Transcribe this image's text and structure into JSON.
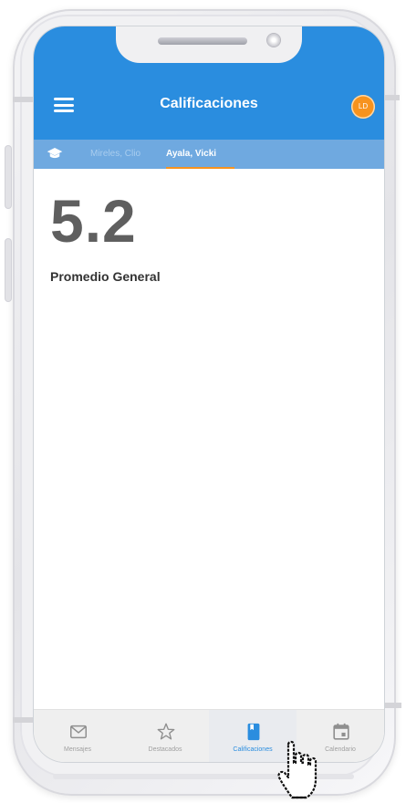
{
  "appbar": {
    "title": "Calificaciones",
    "avatar_initials": "LD",
    "color": "#2a8ddf",
    "avatar_color": "#f7931e"
  },
  "tabs": {
    "items": [
      {
        "label": "Mireles, Clio",
        "active": false
      },
      {
        "label": "Ayala, Vicki",
        "active": true
      }
    ],
    "icon": "graduation-cap-icon"
  },
  "main": {
    "grade": "5.2",
    "grade_label": "Promedio General"
  },
  "bottom_nav": {
    "items": [
      {
        "label": "Mensajes",
        "icon": "mail-icon",
        "active": false
      },
      {
        "label": "Destacados",
        "icon": "star-icon",
        "active": false
      },
      {
        "label": "Calificaciones",
        "icon": "book-icon",
        "active": true
      },
      {
        "label": "Calendario",
        "icon": "calendar-icon",
        "active": false
      }
    ]
  }
}
